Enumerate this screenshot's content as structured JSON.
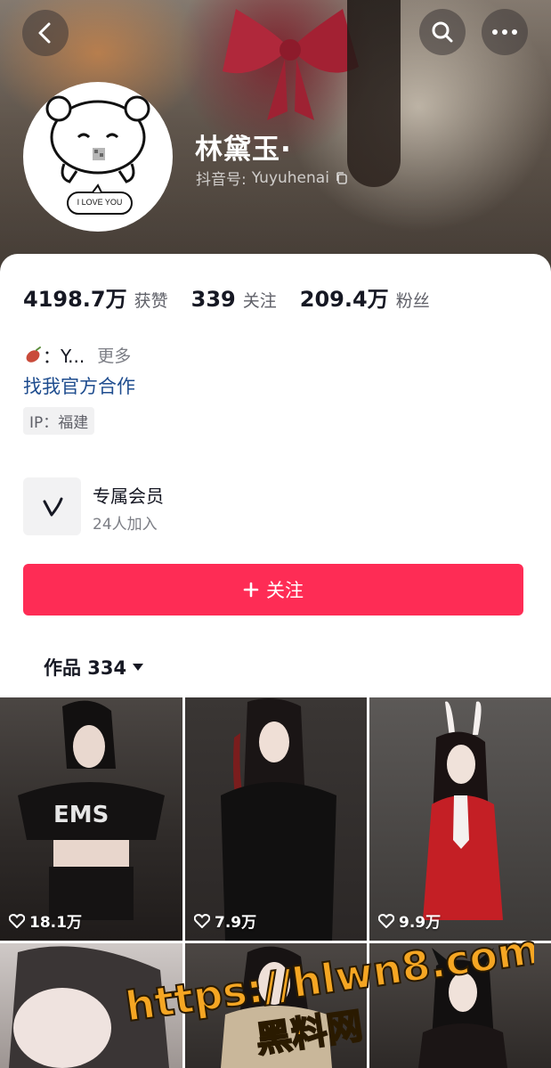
{
  "header": {
    "back_icon": "chevron-left-icon",
    "search_icon": "search-icon",
    "more_icon": "more-horizontal-icon"
  },
  "profile": {
    "avatar_caption": "I LOVE YOU",
    "name": "林黛玉·",
    "douyin_id_label": "抖音号:",
    "douyin_id": "Yuyuhenai"
  },
  "stats": [
    {
      "value": "4198.7万",
      "label": "获赞"
    },
    {
      "value": "339",
      "label": "关注"
    },
    {
      "value": "209.4万",
      "label": "粉丝"
    }
  ],
  "bio": {
    "text": "：Y...",
    "more": "更多",
    "cooperation": "找我官方合作",
    "ip": "IP：福建"
  },
  "membership": {
    "title": "专属会员",
    "subtitle": "24人加入"
  },
  "follow_button": {
    "plus": "+",
    "label": "关注"
  },
  "works_tab": {
    "label": "作品 334"
  },
  "videos": [
    {
      "likes": "18.1万"
    },
    {
      "likes": "7.9万"
    },
    {
      "likes": "9.9万"
    },
    {
      "likes": ""
    },
    {
      "likes": ""
    },
    {
      "likes": ""
    }
  ],
  "watermark": {
    "line1": "https://hlwn8.com",
    "line2": "黑料网"
  },
  "colors": {
    "follow_red": "#fe2c55",
    "link_blue": "#1f4d8f"
  }
}
